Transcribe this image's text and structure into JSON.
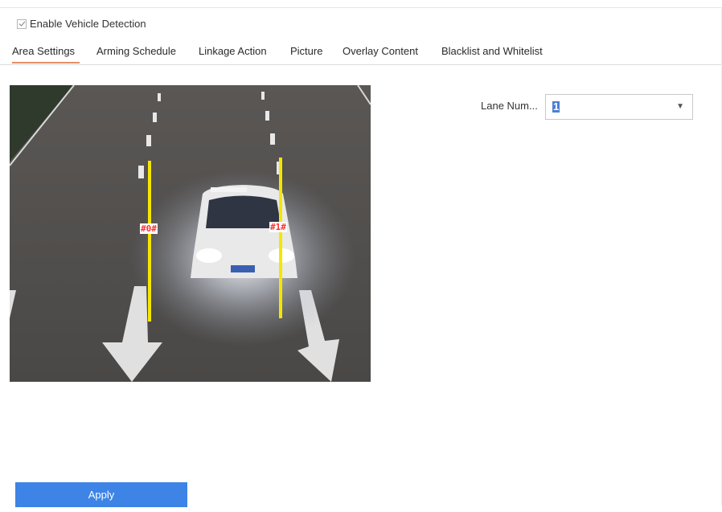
{
  "enable": {
    "label": "Enable Vehicle Detection",
    "checked": true
  },
  "tabs": [
    {
      "label": "Area Settings",
      "active": true
    },
    {
      "label": "Arming Schedule",
      "active": false
    },
    {
      "label": "Linkage Action",
      "active": false
    },
    {
      "label": "Picture",
      "active": false
    },
    {
      "label": "Overlay Content",
      "active": false
    },
    {
      "label": "Blacklist and Whitelist",
      "active": false
    }
  ],
  "preview": {
    "lane_lines": [
      {
        "label": "#0#"
      },
      {
        "label": "#1#"
      }
    ],
    "line_color": "#f5e600"
  },
  "lane_number": {
    "label": "Lane Num...",
    "value": "1"
  },
  "apply": {
    "label": "Apply"
  },
  "colors": {
    "accent": "#3d84e6",
    "tab_underline": "#e58d6a"
  }
}
